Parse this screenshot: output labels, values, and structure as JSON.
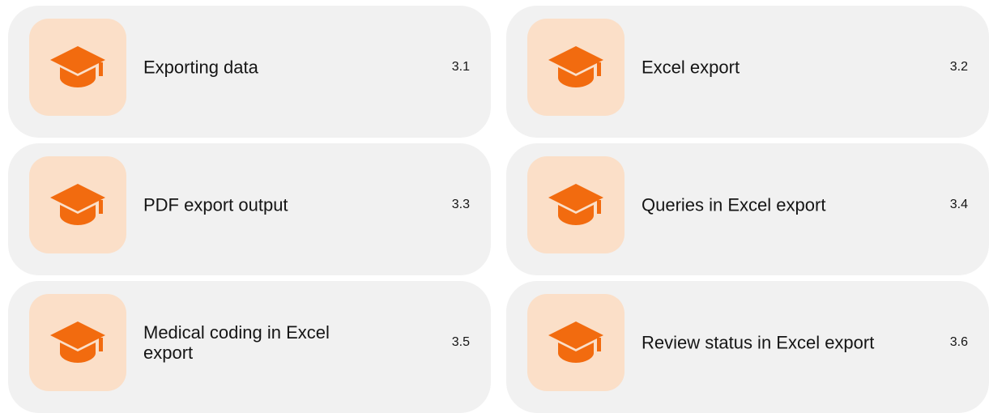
{
  "accent_color": "#f26b0f",
  "icon_bg_color": "#fbdfc8",
  "card_bg_color": "#f1f1f1",
  "cards": [
    {
      "title": "Exporting data",
      "number": "3.1",
      "icon": "graduation-cap-icon"
    },
    {
      "title": "Excel export",
      "number": "3.2",
      "icon": "graduation-cap-icon"
    },
    {
      "title": "PDF export output",
      "number": "3.3",
      "icon": "graduation-cap-icon"
    },
    {
      "title": "Queries in Excel export",
      "number": "3.4",
      "icon": "graduation-cap-icon"
    },
    {
      "title": "Medical coding in Excel export",
      "number": "3.5",
      "icon": "graduation-cap-icon"
    },
    {
      "title": "Review status in Excel export",
      "number": "3.6",
      "icon": "graduation-cap-icon"
    }
  ]
}
